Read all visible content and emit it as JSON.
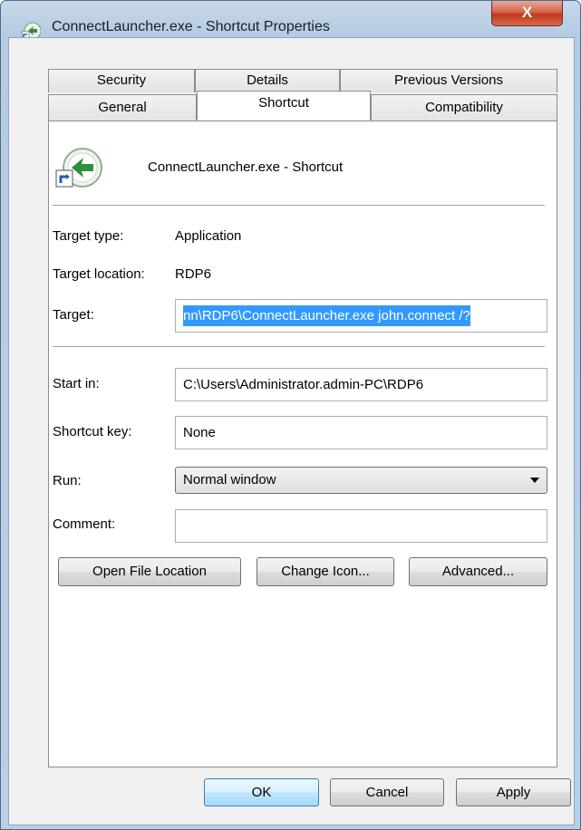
{
  "window": {
    "title": "ConnectLauncher.exe - Shortcut Properties",
    "close_label": "X"
  },
  "tabs": {
    "row1": [
      "Security",
      "Details",
      "Previous Versions"
    ],
    "row2": [
      "General",
      "Shortcut",
      "Compatibility"
    ],
    "active": "Shortcut"
  },
  "header": {
    "name": "ConnectLauncher.exe - Shortcut",
    "icon": "shortcut-arrow-icon"
  },
  "fields": {
    "target_type_label": "Target type:",
    "target_type_value": "Application",
    "target_location_label": "Target location:",
    "target_location_value": "RDP6",
    "target_label": "Target:",
    "target_value": "nn\\RDP6\\ConnectLauncher.exe john.connect /?",
    "start_in_label": "Start in:",
    "start_in_value": "C:\\Users\\Administrator.admin-PC\\RDP6",
    "shortcut_key_label": "Shortcut key:",
    "shortcut_key_value": "None",
    "run_label": "Run:",
    "run_value": "Normal window",
    "comment_label": "Comment:",
    "comment_value": ""
  },
  "actions": {
    "open_file_location": "Open File Location",
    "change_icon": "Change Icon...",
    "advanced": "Advanced..."
  },
  "footer": {
    "ok": "OK",
    "cancel": "Cancel",
    "apply": "Apply"
  },
  "colors": {
    "selection": "#3399ff",
    "close_button": "#c0391f"
  }
}
